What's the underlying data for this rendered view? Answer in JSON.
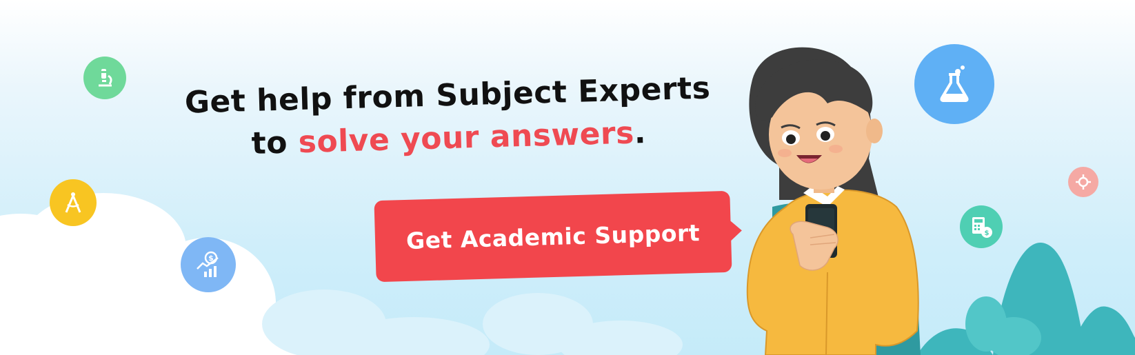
{
  "headline": {
    "line1": "Get help from Subject Experts",
    "line2_prefix": "to ",
    "line2_highlight": "solve your answers",
    "line2_suffix": "."
  },
  "cta": {
    "label": "Get Academic Support"
  },
  "colors": {
    "accent": "#ef4a52",
    "cta_background": "#f2464c",
    "text": "#111111",
    "bubble_green": "#6fd99a",
    "bubble_yellow": "#f8c522",
    "bubble_blue": "#7fb7f5",
    "bubble_sky": "#5fb0f5",
    "bubble_teal": "#4fcfb3",
    "bubble_pink": "#f5a9a4",
    "sweater": "#f6b93f",
    "hills": "#3eb6bc"
  },
  "icons": [
    "microscope-icon",
    "compass-icon",
    "finance-growth-icon",
    "flask-icon",
    "calculator-money-icon",
    "settings-target-icon"
  ]
}
